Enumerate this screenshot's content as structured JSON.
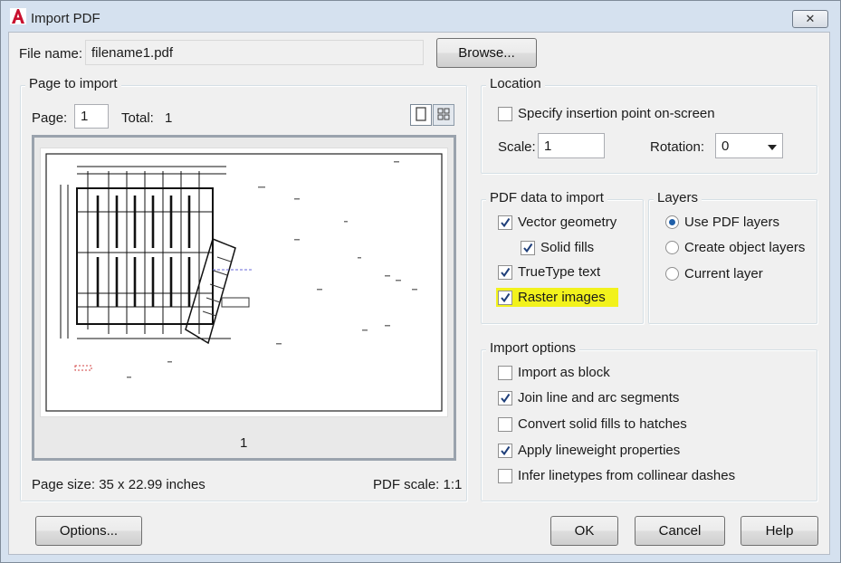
{
  "window": {
    "title": "Import PDF",
    "app_icon_letter": "A",
    "close_glyph": "✕"
  },
  "file": {
    "label": "File name:",
    "value": "filename1.pdf",
    "browse_label": "Browse..."
  },
  "page_to_import": {
    "title": "Page to import",
    "page_label": "Page:",
    "page_value": "1",
    "total_label": "Total:",
    "total_value": "1",
    "preview_page_number": "1",
    "page_size": "Page size:  35 x 22.99 inches",
    "pdf_scale": "PDF scale:  1:1",
    "view_modes": [
      "single-page-view-icon",
      "thumbnail-grid-icon"
    ]
  },
  "location": {
    "title": "Location",
    "specify_onscreen": {
      "label": "Specify insertion point on-screen",
      "checked": false
    },
    "scale_label": "Scale:",
    "scale_value": "1",
    "rotation_label": "Rotation:",
    "rotation_value": "0"
  },
  "pdf_data": {
    "title": "PDF data to import",
    "items": [
      {
        "label": "Vector geometry",
        "checked": true
      },
      {
        "label": "Solid fills",
        "checked": true
      },
      {
        "label": "TrueType text",
        "checked": true
      },
      {
        "label": "Raster images",
        "checked": true,
        "highlighted": true
      }
    ]
  },
  "layers": {
    "title": "Layers",
    "options": [
      {
        "label": "Use PDF layers",
        "selected": true
      },
      {
        "label": "Create object layers",
        "selected": false
      },
      {
        "label": "Current layer",
        "selected": false
      }
    ]
  },
  "import_options": {
    "title": "Import options",
    "items": [
      {
        "label": "Import as block",
        "checked": false
      },
      {
        "label": "Join line and arc segments",
        "checked": true
      },
      {
        "label": "Convert solid fills to hatches",
        "checked": false
      },
      {
        "label": "Apply lineweight properties",
        "checked": true
      },
      {
        "label": "Infer linetypes from collinear dashes",
        "checked": false
      }
    ]
  },
  "buttons": {
    "options": "Options...",
    "ok": "OK",
    "cancel": "Cancel",
    "help": "Help"
  },
  "colors": {
    "accent": "#1f5fa8",
    "app_icon": "#c8102e",
    "highlight": "#f2f21c"
  }
}
